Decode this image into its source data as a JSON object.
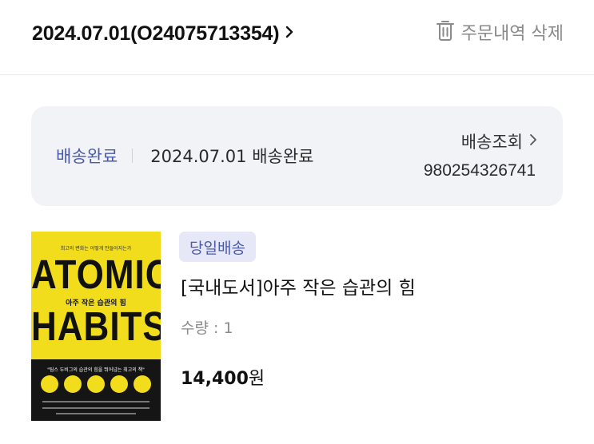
{
  "header": {
    "order_title": "2024.07.01(O24075713354)",
    "delete_label": "주문내역 삭제"
  },
  "status": {
    "label": "배송완료",
    "detail": "2024.07.01 배송완료",
    "tracking_label": "배송조회",
    "tracking_number": "980254326741"
  },
  "product": {
    "badge": "당일배송",
    "title": "[국내도서]아주 작은 습관의 힘",
    "quantity": "수량 : 1",
    "price": "14,400",
    "price_unit": "원",
    "cover": {
      "top_text": "최고의 변화는 어떻게 만들어지는가",
      "title_line1": "ATOMIC",
      "subtitle": "아주 작은 습관의 힘",
      "title_line2": "HABITS",
      "quote": "\"팀스 두비그의 습관의 힘을 뛰어넘는 최고의 책\""
    }
  },
  "colors": {
    "accent": "#4a5aa8",
    "card_bg": "#f2f3f7",
    "badge_bg": "#e7e8f7",
    "cover_yellow": "#f1dd1c"
  }
}
